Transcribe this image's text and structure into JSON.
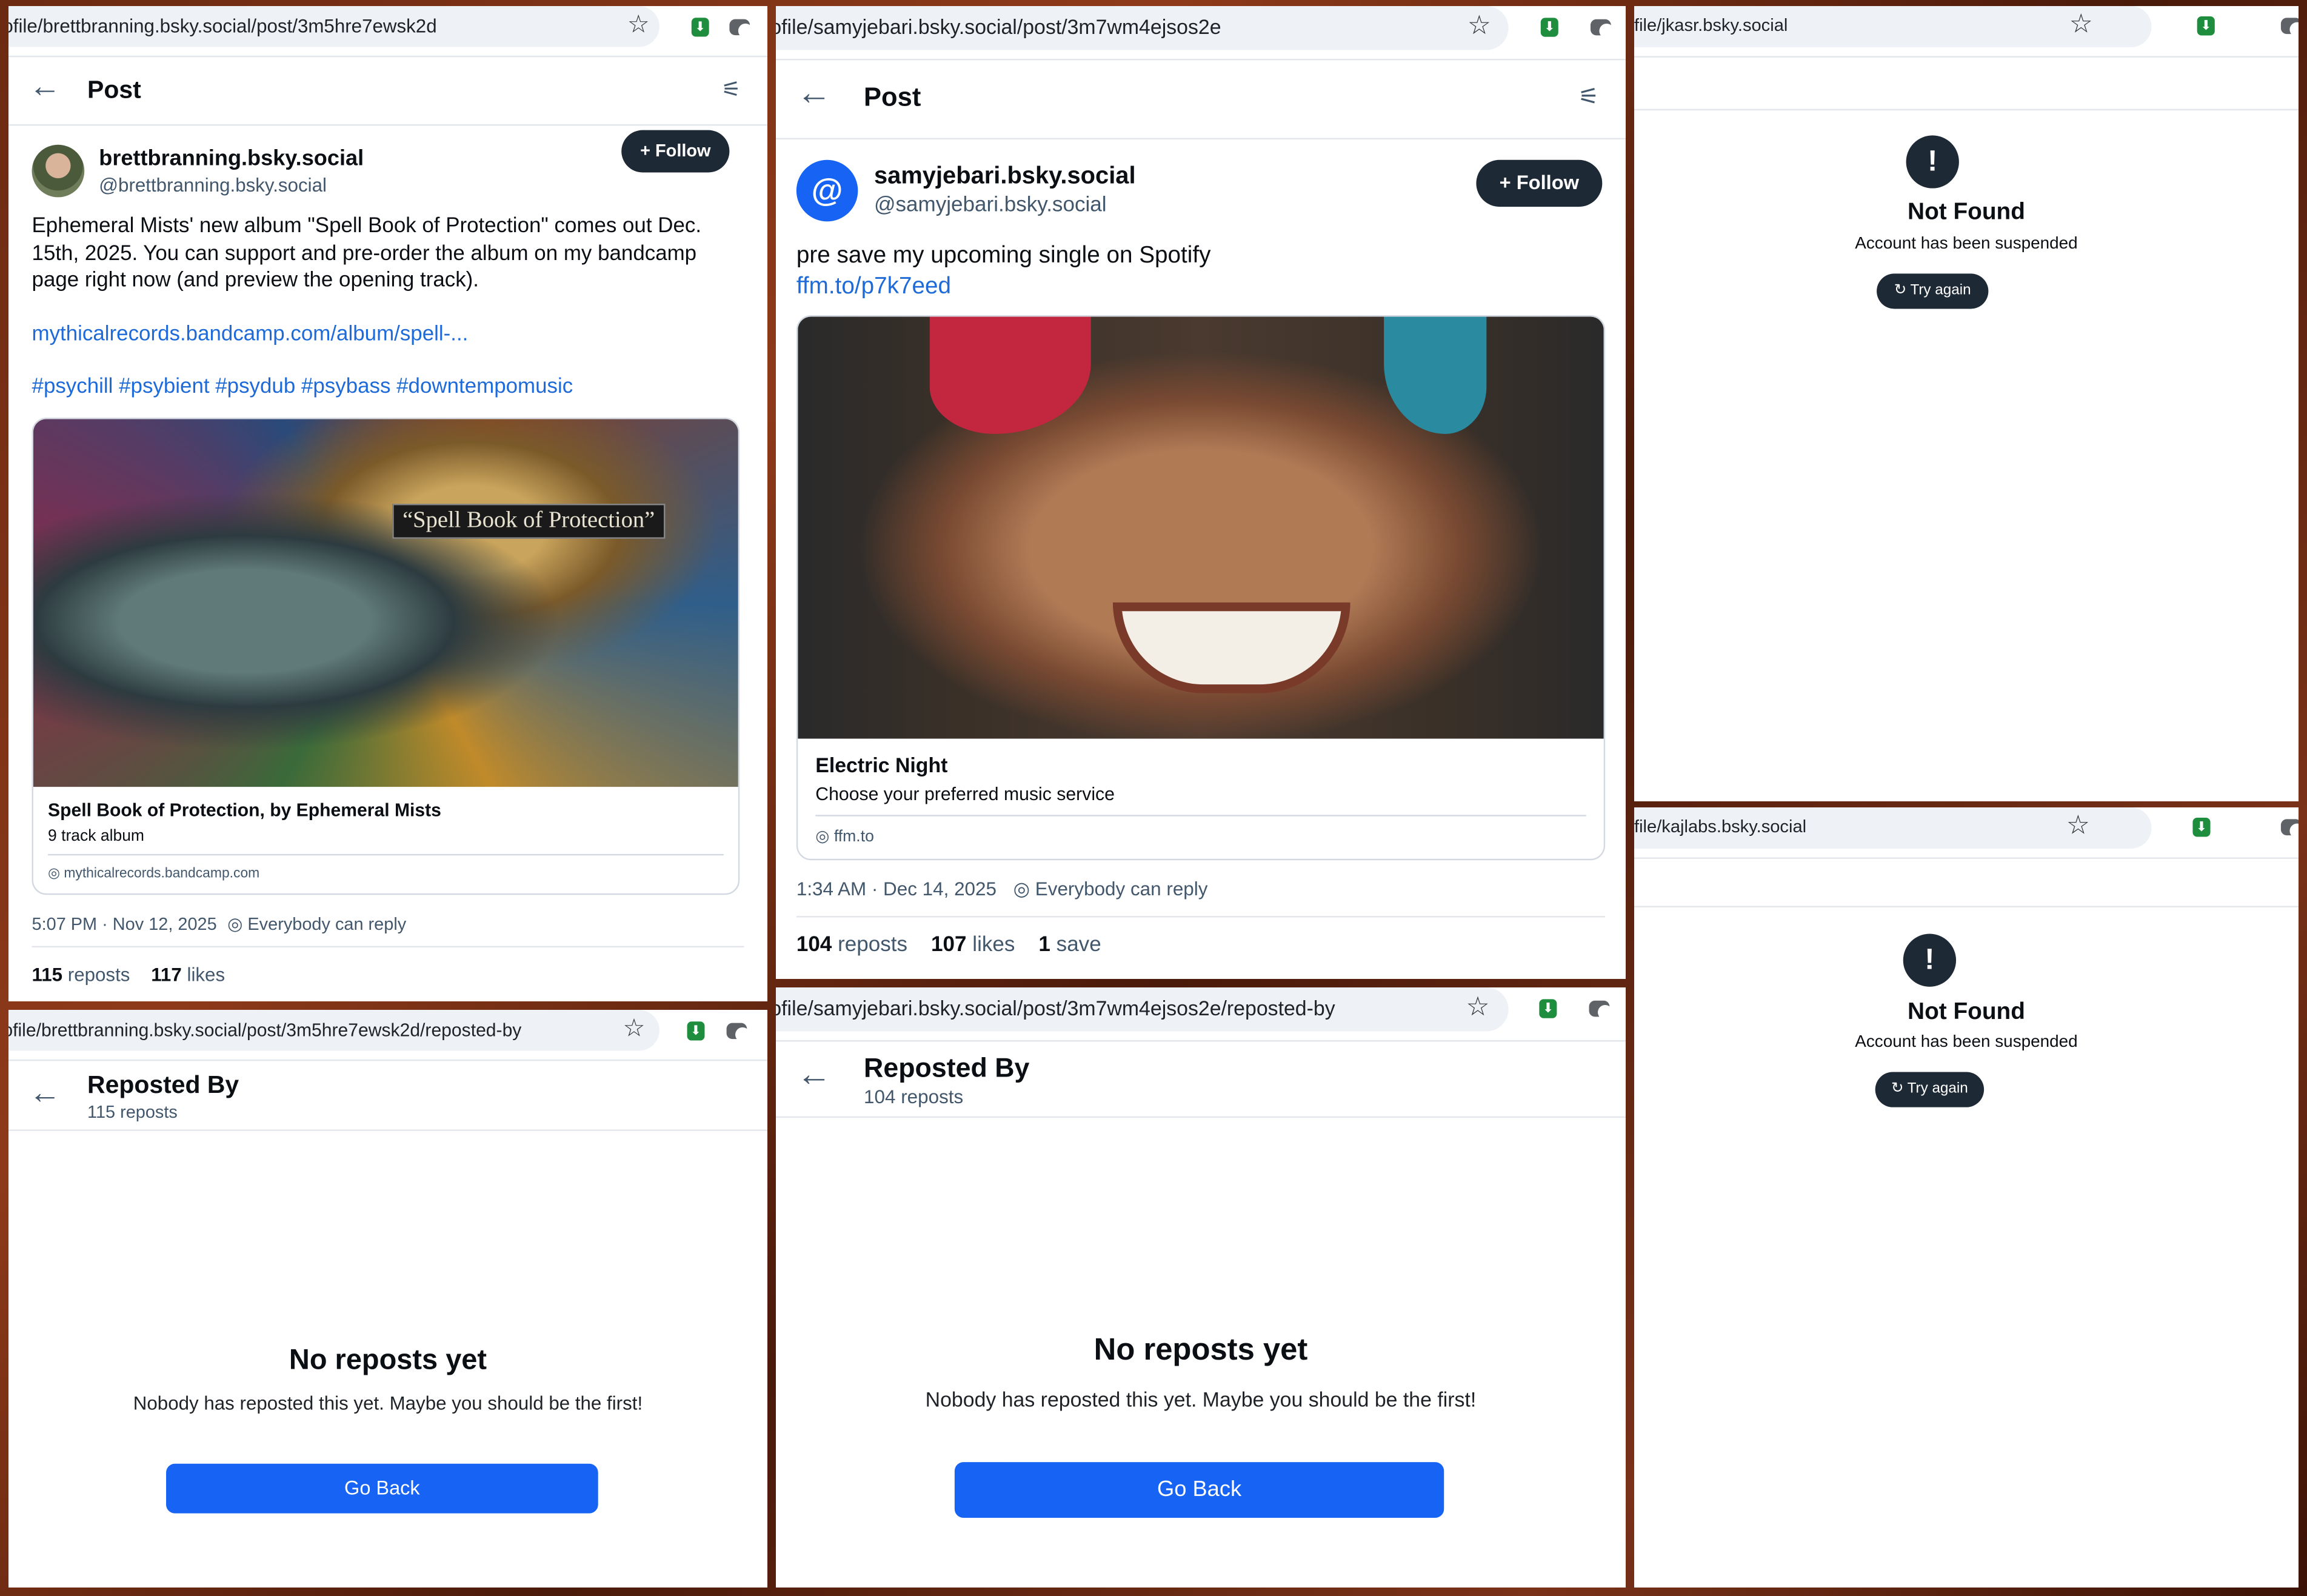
{
  "panel1": {
    "url": "ofile/brettbranning.bsky.social/post/3m5hre7ewsk2d",
    "header_title": "Post",
    "display_name": "brettbranning.bsky.social",
    "handle": "@brettbranning.bsky.social",
    "follow_label": "+ Follow",
    "text_line1": "Ephemeral Mists' new album \"Spell Book of Protection\" comes out Dec.",
    "text_line2": "15th, 2025.  You can support and pre-order the album on my bandcamp",
    "text_line3": "page right now (and preview the opening track).",
    "link": "mythicalrecords.bandcamp.com/album/spell-...",
    "hashtags": "#psychill #psybient #psydub #psybass #downtempomusic",
    "image_caption": "“Spell Book of Protection”",
    "card_title": "Spell Book of Protection, by Ephemeral Mists",
    "card_desc": "9 track album",
    "card_domain": "mythicalrecords.bandcamp.com",
    "timestamp": "5:07 PM · Nov 12, 2025",
    "reply_setting": "Everybody can reply",
    "reposts_count": "115",
    "reposts_label": "reposts",
    "likes_count": "117",
    "likes_label": "likes"
  },
  "panel2": {
    "url": "ofile/samyjebari.bsky.social/post/3m7wm4ejsos2e",
    "header_title": "Post",
    "avatar_glyph": "@",
    "display_name": "samyjebari.bsky.social",
    "handle": "@samyjebari.bsky.social",
    "follow_label": "+ Follow",
    "text": "pre save my upcoming single on Spotify",
    "link": "ffm.to/p7k7eed",
    "card_title": "Electric Night",
    "card_desc": "Choose your preferred music service",
    "card_domain": "ffm.to",
    "timestamp": "1:34 AM · Dec 14, 2025",
    "reply_setting": "Everybody can reply",
    "reposts_count": "104",
    "reposts_label": "reposts",
    "likes_count": "107",
    "likes_label": "likes",
    "saves_count": "1",
    "saves_label": "save"
  },
  "panel3": {
    "url": "file/jkasr.bsky.social",
    "icon_glyph": "!",
    "title": "Not Found",
    "subtitle": "Account has been suspended",
    "retry_label": "Try again"
  },
  "panel4": {
    "url": "ofile/brettbranning.bsky.social/post/3m5hre7ewsk2d/reposted-by",
    "header_title": "Reposted By",
    "header_sub": "115 reposts",
    "empty_title": "No reposts yet",
    "empty_sub": "Nobody has reposted this yet. Maybe you should be the first!",
    "button": "Go Back"
  },
  "panel5": {
    "url": "ofile/samyjebari.bsky.social/post/3m7wm4ejsos2e/reposted-by",
    "header_title": "Reposted By",
    "header_sub": "104 reposts",
    "empty_title": "No reposts yet",
    "empty_sub": "Nobody has reposted this yet. Maybe you should be the first!",
    "button": "Go Back"
  },
  "panel6": {
    "url": "file/kajlabs.bsky.social",
    "icon_glyph": "!",
    "title": "Not Found",
    "subtitle": "Account has been suspended",
    "retry_label": "Try again"
  },
  "colors": {
    "accent_blue": "#1764f4",
    "link_blue": "#1d6ad8",
    "dark_button": "#1e2936",
    "extension_green": "#1e8e3e",
    "background_brown": "#6b2a12"
  },
  "icons": [
    "back-arrow-icon",
    "tune-icon",
    "star-icon",
    "extension-icon",
    "camera-icon",
    "globe-icon",
    "plus-icon",
    "refresh-icon",
    "exclamation-icon"
  ]
}
